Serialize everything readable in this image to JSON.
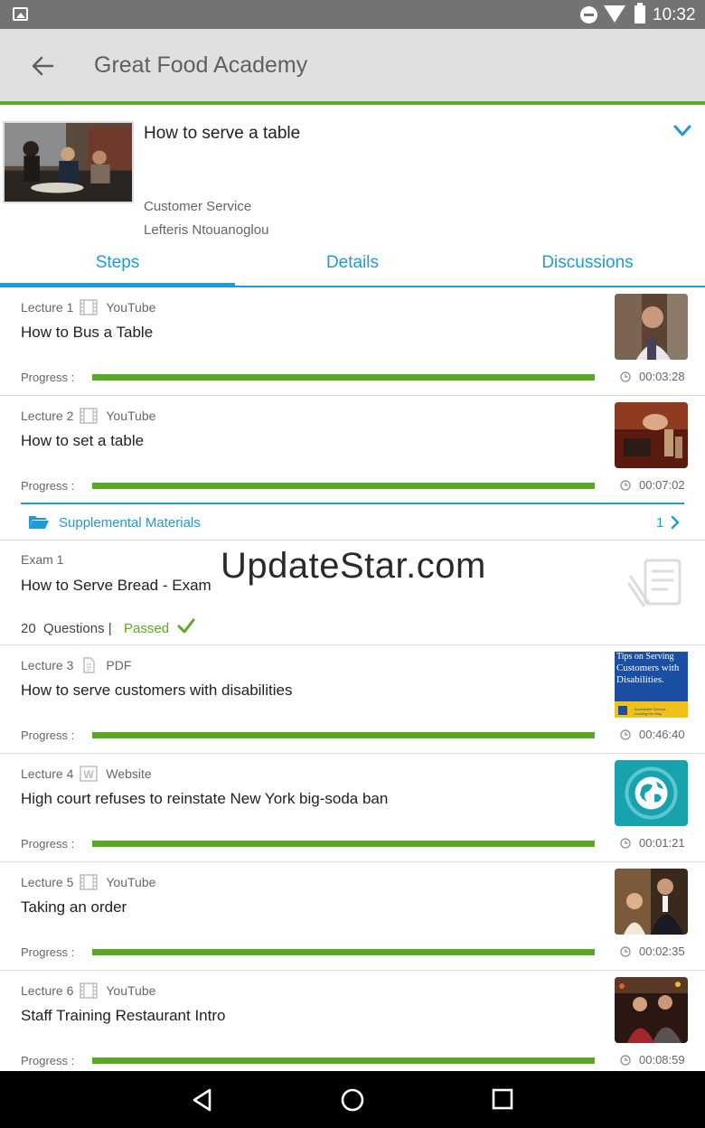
{
  "status_bar": {
    "time": "10:32",
    "icons": [
      "gallery-icon",
      "dnd-icon",
      "wifi-icon",
      "battery-icon"
    ]
  },
  "app_bar": {
    "title": "Great Food Academy",
    "back_icon": "arrow-back-icon"
  },
  "course": {
    "title": "How to serve a table",
    "category": "Customer Service",
    "author": "Lefteris Ntouanoglou",
    "expand_icon": "chevron-down-icon"
  },
  "tabs": [
    {
      "label": "Steps",
      "active": true
    },
    {
      "label": "Details",
      "active": false
    },
    {
      "label": "Discussions",
      "active": false
    }
  ],
  "items": [
    {
      "kind": "lecture",
      "number": "Lecture 1",
      "source": "YouTube",
      "title": "How to Bus a Table",
      "progress_label": "Progress :",
      "progress": 1.0,
      "duration": "00:03:28"
    },
    {
      "kind": "lecture",
      "number": "Lecture 2",
      "source": "YouTube",
      "title": "How to set a table",
      "progress_label": "Progress :",
      "progress": 1.0,
      "duration": "00:07:02"
    },
    {
      "kind": "exam",
      "number": "Exam 1",
      "title": "How to Serve Bread - Exam",
      "questions_count": "20",
      "questions_label": "Questions |",
      "status": "Passed"
    },
    {
      "kind": "lecture",
      "number": "Lecture 3",
      "source": "PDF",
      "title": "How to serve customers with disabilities",
      "progress_label": "Progress :",
      "progress": 1.0,
      "duration": "00:46:40"
    },
    {
      "kind": "lecture",
      "number": "Lecture 4",
      "source": "Website",
      "title": "High court refuses to reinstate New York big-soda ban",
      "progress_label": "Progress :",
      "progress": 1.0,
      "duration": "00:01:21"
    },
    {
      "kind": "lecture",
      "number": "Lecture 5",
      "source": "YouTube",
      "title": "Taking an order",
      "progress_label": "Progress :",
      "progress": 1.0,
      "duration": "00:02:35"
    },
    {
      "kind": "lecture",
      "number": "Lecture 6",
      "source": "YouTube",
      "title": "Staff Training Restaurant Intro",
      "progress_label": "Progress :",
      "progress": 1.0,
      "duration": "00:08:59"
    }
  ],
  "supplemental": {
    "label": "Supplemental Materials",
    "count": "1"
  },
  "pdf_thumb_text": {
    "line1": "Tips on Serving",
    "line2": "Customers with",
    "line3": "Disabilities.",
    "footer1": "Accessible Schools",
    "footer2": "Leading the Way"
  },
  "watermark": "UpdateStar.com",
  "colors": {
    "accent": "#1e9bd7",
    "progress": "#5aa823",
    "app_bar": "#e0e0e0",
    "status_bar": "#737373"
  }
}
